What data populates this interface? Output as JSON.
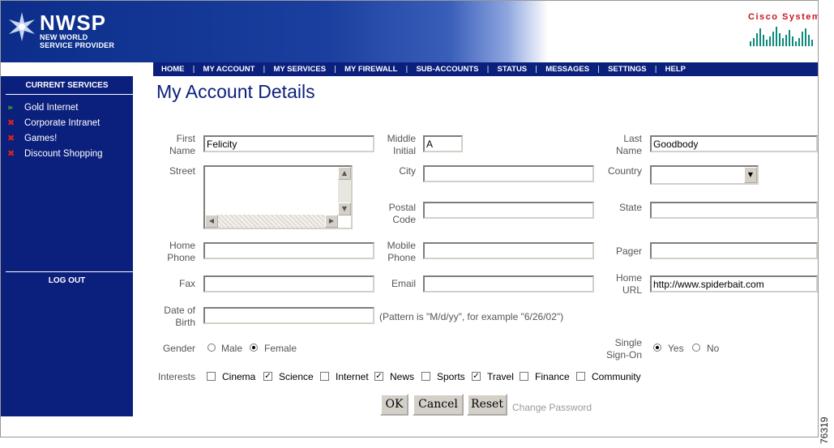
{
  "brand": {
    "logo_name": "NWSP",
    "logo_sub_1": "NEW WORLD",
    "logo_sub_2": "SERVICE PROVIDER",
    "cisco_name": "Cisco Systems",
    "cisco_color": "#c8161e"
  },
  "nav": {
    "items": [
      "HOME",
      "MY ACCOUNT",
      "MY SERVICES",
      "MY FIREWALL",
      "SUB-ACCOUNTS",
      "STATUS",
      "MESSAGES",
      "SETTINGS",
      "HELP"
    ],
    "bg_color": "#0b1f7c"
  },
  "sidebar": {
    "heading": "CURRENT SERVICES",
    "items": [
      {
        "label": "Gold Internet",
        "status": "active",
        "icon": "double-arrow-icon"
      },
      {
        "label": "Corporate Intranet",
        "status": "inactive",
        "icon": "x-icon"
      },
      {
        "label": "Games!",
        "status": "inactive",
        "icon": "x-icon"
      },
      {
        "label": "Discount Shopping",
        "status": "inactive",
        "icon": "x-icon"
      }
    ],
    "logout": "LOG OUT"
  },
  "page": {
    "title": "My Account Details"
  },
  "form": {
    "first_name_label_1": "First",
    "first_name_label_2": "Name",
    "first_name": "Felicity",
    "middle_initial_label_1": "Middle",
    "middle_initial_label_2": "Initial",
    "middle_initial": "A",
    "last_name_label_1": "Last",
    "last_name_label_2": "Name",
    "last_name": "Goodbody",
    "street_label": "Street",
    "street": "",
    "city_label": "City",
    "city": "",
    "country_label": "Country",
    "country": "",
    "postal_code_label_1": "Postal",
    "postal_code_label_2": "Code",
    "postal_code": "",
    "state_label": "State",
    "state": "",
    "home_phone_label_1": "Home",
    "home_phone_label_2": "Phone",
    "home_phone": "",
    "mobile_phone_label_1": "Mobile",
    "mobile_phone_label_2": "Phone",
    "mobile_phone": "",
    "pager_label": "Pager",
    "pager": "",
    "fax_label": "Fax",
    "fax": "",
    "email_label": "Email",
    "email": "",
    "home_url_label_1": "Home",
    "home_url_label_2": "URL",
    "home_url": "http://www.spiderbait.com",
    "dob_label_1": "Date of",
    "dob_label_2": "Birth",
    "dob": "",
    "dob_hint": "(Pattern is \"M/d/yy\", for example \"6/26/02\")",
    "gender_label": "Gender",
    "gender_options": [
      "Male",
      "Female"
    ],
    "gender_selected": "Female",
    "sso_label_1": "Single",
    "sso_label_2": "Sign-On",
    "sso_options": [
      "Yes",
      "No"
    ],
    "sso_selected": "Yes",
    "interests_label": "Interests",
    "interests": [
      {
        "label": "Cinema",
        "checked": false
      },
      {
        "label": "Science",
        "checked": true
      },
      {
        "label": "Internet",
        "checked": false
      },
      {
        "label": "News",
        "checked": true
      },
      {
        "label": "Sports",
        "checked": false
      },
      {
        "label": "Travel",
        "checked": true
      },
      {
        "label": "Finance",
        "checked": false
      },
      {
        "label": "Community",
        "checked": false
      }
    ]
  },
  "buttons": {
    "ok": "OK",
    "cancel": "Cancel",
    "reset": "Reset",
    "change_password": "Change Password"
  },
  "figure_id": "76319"
}
